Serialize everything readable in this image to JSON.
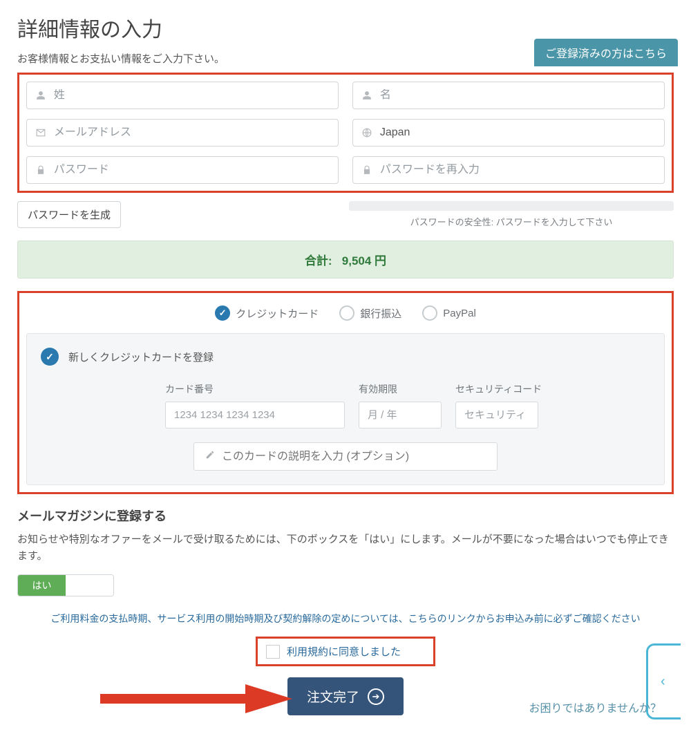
{
  "header": {
    "title": "詳細情報の入力",
    "subtitle": "お客様情報とお支払い情報をご入力下さい。",
    "login_button": "ご登録済みの方はこちら"
  },
  "fields": {
    "last_name_ph": "姓",
    "first_name_ph": "名",
    "email_ph": "メールアドレス",
    "country_value": "Japan",
    "password_ph": "パスワード",
    "password_confirm_ph": "パスワードを再入力"
  },
  "password": {
    "generate_label": "パスワードを生成",
    "strength_label": "パスワードの安全性: パスワードを入力して下さい"
  },
  "total": {
    "label": "合計:",
    "amount": "9,504 円"
  },
  "payment_methods": {
    "credit": "クレジットカード",
    "bank": "銀行振込",
    "paypal": "PayPal"
  },
  "credit_card": {
    "register_new": "新しくクレジットカードを登録",
    "number_label": "カード番号",
    "number_ph": "1234 1234 1234 1234",
    "expiry_label": "有効期限",
    "expiry_ph": "月 / 年",
    "cvv_label": "セキュリティコード",
    "cvv_ph": "セキュリティ",
    "desc_ph": "このカードの説明を入力 (オプション)"
  },
  "newsletter": {
    "title": "メールマガジンに登録する",
    "desc": "お知らせや特別なオファーをメールで受け取るためには、下のボックスを「はい」にします。メールが不要になった場合はいつでも停止できます。",
    "yes": "はい"
  },
  "terms": {
    "line": "ご利用料金の支払時期、サービス利用の開始時期及び契約解除の定めについては、こちらのリンクからお申込み前に必ずご確認ください",
    "agree": "利用規約に同意しました"
  },
  "submit": "注文完了",
  "help": "お困りではありませんか？"
}
